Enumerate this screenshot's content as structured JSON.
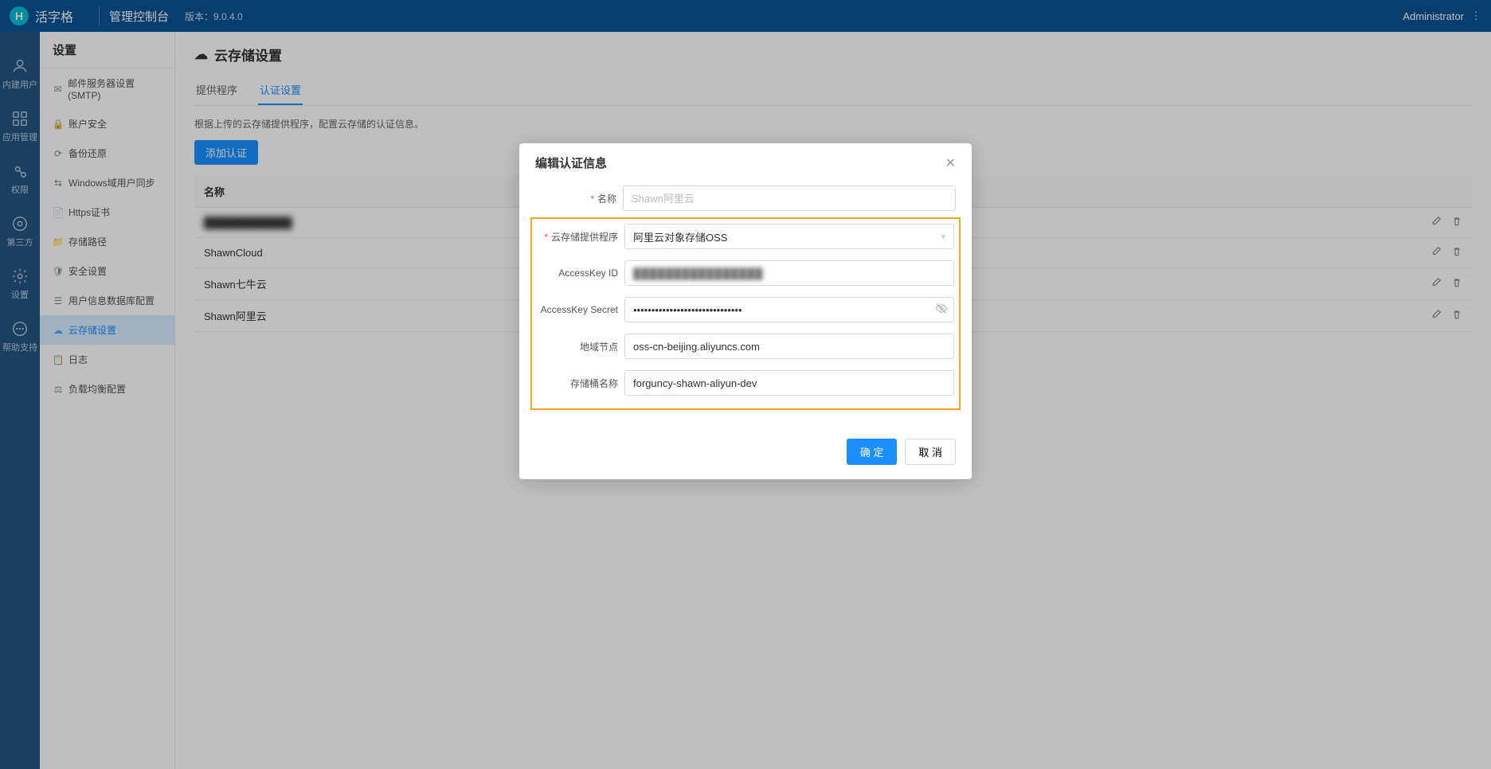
{
  "header": {
    "logo_letter": "H",
    "brand": "活字格",
    "console": "管理控制台",
    "version_label": "版本：9.0.4.0",
    "user": "Administrator"
  },
  "rail": {
    "items": [
      {
        "label": "内建用户"
      },
      {
        "label": "应用管理"
      },
      {
        "label": "权限"
      },
      {
        "label": "第三方"
      },
      {
        "label": "设置"
      },
      {
        "label": "帮助支持"
      }
    ]
  },
  "sidebar": {
    "title": "设置",
    "items": [
      {
        "label": "邮件服务器设置(SMTP)"
      },
      {
        "label": "账户安全"
      },
      {
        "label": "备份还原"
      },
      {
        "label": "Windows域用户同步"
      },
      {
        "label": "Https证书"
      },
      {
        "label": "存储路径"
      },
      {
        "label": "安全设置"
      },
      {
        "label": "用户信息数据库配置"
      },
      {
        "label": "云存储设置"
      },
      {
        "label": "日志"
      },
      {
        "label": "负载均衡配置"
      }
    ],
    "active_index": 8
  },
  "page": {
    "title": "云存储设置",
    "tabs": [
      {
        "label": "提供程序"
      },
      {
        "label": "认证设置"
      }
    ],
    "active_tab": 1,
    "description": "根据上传的云存储提供程序，配置云存储的认证信息。",
    "add_button": "添加认证",
    "table": {
      "header_name": "名称",
      "rows": [
        {
          "name": "████████████"
        },
        {
          "name": "ShawnCloud"
        },
        {
          "name": "Shawn七牛云"
        },
        {
          "name": "Shawn阿里云"
        }
      ]
    }
  },
  "modal": {
    "title": "编辑认证信息",
    "fields": {
      "name_label": "名称",
      "name_placeholder": "Shawn阿里云",
      "provider_label": "云存储提供程序",
      "provider_value": "阿里云对象存储OSS",
      "access_key_id_label": "AccessKey ID",
      "access_key_id_value": "████████████████",
      "access_key_secret_label": "AccessKey Secret",
      "access_key_secret_value": "••••••••••••••••••••••••••••••",
      "region_label": "地域节点",
      "region_value": "oss-cn-beijing.aliyuncs.com",
      "bucket_label": "存储桶名称",
      "bucket_value": "forguncy-shawn-aliyun-dev"
    },
    "ok": "确 定",
    "cancel": "取 消"
  }
}
